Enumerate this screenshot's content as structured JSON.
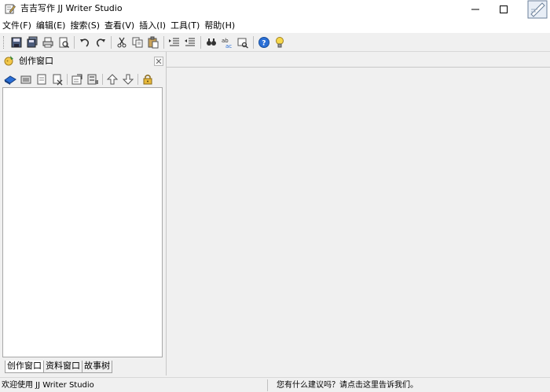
{
  "window": {
    "title": "吉吉写作 JJ Writer Studio"
  },
  "menu": {
    "items": [
      {
        "label": "文件(F)"
      },
      {
        "label": "编辑(E)"
      },
      {
        "label": "搜索(S)"
      },
      {
        "label": "查看(V)"
      },
      {
        "label": "插入(I)"
      },
      {
        "label": "工具(T)"
      },
      {
        "label": "帮助(H)"
      }
    ]
  },
  "toolbar": {
    "buttons": [
      {
        "icon": "save-icon"
      },
      {
        "icon": "save-all-icon"
      },
      {
        "icon": "print-icon"
      },
      {
        "icon": "print-preview-icon"
      },
      {
        "icon": "undo-icon"
      },
      {
        "icon": "redo-icon"
      },
      {
        "icon": "cut-icon"
      },
      {
        "icon": "copy-icon"
      },
      {
        "icon": "paste-icon"
      },
      {
        "icon": "indent-icon"
      },
      {
        "icon": "outdent-icon"
      },
      {
        "icon": "find-icon"
      },
      {
        "icon": "replace-icon"
      },
      {
        "icon": "find-next-icon"
      },
      {
        "icon": "help-icon"
      },
      {
        "icon": "tip-icon"
      }
    ]
  },
  "left_panel": {
    "title": "创作窗口",
    "tabs": [
      {
        "label": "创作窗口",
        "active": true
      },
      {
        "label": "资料窗口",
        "active": false
      },
      {
        "label": "故事树",
        "active": false
      }
    ]
  },
  "status": {
    "left": "欢迎使用 JJ Writer Studio",
    "right": "您有什么建议吗？请点击这里告诉我们。"
  },
  "colors": {
    "titlebar_bg": "#ffffff",
    "chrome_bg": "#f0f0f0",
    "tree_bg": "#ffffff",
    "accent_blue": "#2a6fd6"
  }
}
